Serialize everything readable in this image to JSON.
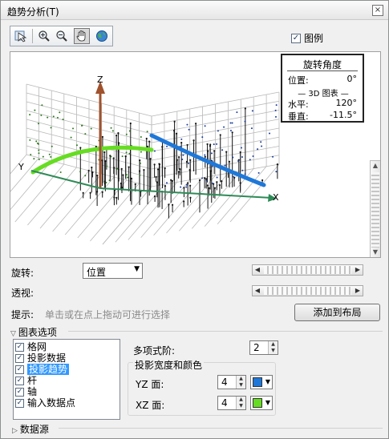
{
  "window": {
    "title": "趋势分析(T)",
    "close_glyph": "×"
  },
  "toolbar": {
    "icons": [
      "select-icon",
      "zoom-in-icon",
      "zoom-out-icon",
      "pan-hand-icon",
      "globe-icon"
    ]
  },
  "legend": {
    "label": "图例",
    "checked": true
  },
  "chart": {
    "axis_x": "X",
    "axis_y": "Y",
    "axis_z": "Z",
    "colors": {
      "yz_trend": "#66dd22",
      "xz_trend": "#1f78d8",
      "grid": "#b8b8b8",
      "stick": "#111111",
      "axis_arrow": "#a0522d"
    }
  },
  "info_box": {
    "title": "旋转角度",
    "position_label": "位置:",
    "position_value": "0°",
    "subtitle": "3D 图表",
    "horizontal_label": "水平:",
    "horizontal_value": "120°",
    "vertical_label": "垂直:",
    "vertical_value": "-11.5°"
  },
  "controls": {
    "rotate_label": "旋转:",
    "rotate_value": "位置",
    "perspective_label": "透视:",
    "hint_label": "提示:",
    "hint_text": "单击或在点上拖动可进行选择",
    "add_to_layout": "添加到布局"
  },
  "chart_options": {
    "header": "图表选项",
    "items": [
      {
        "label": "格网",
        "checked": true,
        "selected": false
      },
      {
        "label": "投影数据",
        "checked": true,
        "selected": false
      },
      {
        "label": "投影趋势",
        "checked": true,
        "selected": true
      },
      {
        "label": "杆",
        "checked": true,
        "selected": false
      },
      {
        "label": "轴",
        "checked": true,
        "selected": false
      },
      {
        "label": "输入数据点",
        "checked": true,
        "selected": false
      }
    ],
    "poly_order_label": "多项式阶:",
    "poly_order_value": "2",
    "proj_group_label": "投影宽度和颜色",
    "yz_label": "YZ 面:",
    "yz_width": "4",
    "yz_color": "#1f78d8",
    "xz_label": "XZ 面:",
    "xz_width": "4",
    "xz_color": "#66dd22"
  },
  "footer": {
    "data_source": "数据源"
  }
}
